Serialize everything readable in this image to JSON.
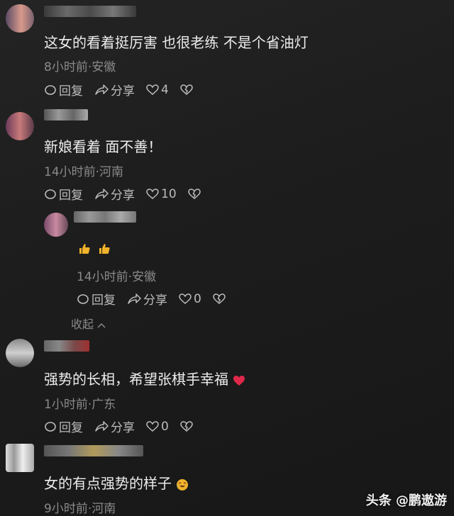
{
  "comments": [
    {
      "text": "这女的看着挺厉害 也很老练  不是个省油灯",
      "meta": "8小时前·安徽",
      "reply": "回复",
      "share": "分享",
      "likes": "4"
    },
    {
      "text": "新娘看着 面不善！",
      "meta": "14小时前·河南",
      "reply": "回复",
      "share": "分享",
      "likes": "10"
    },
    {
      "text": "",
      "meta": "14小时前·安徽",
      "reply": "回复",
      "share": "分享",
      "likes": "0"
    },
    {
      "text": "强势的长相，希望张棋手幸福",
      "meta": "1小时前·广东",
      "reply": "回复",
      "share": "分享",
      "likes": "0"
    },
    {
      "text": "女的有点强势的样子",
      "meta": "9小时前·河南",
      "reply": "",
      "share": "",
      "likes": ""
    }
  ],
  "collapse_label": "收起",
  "watermark": "头条 @鹏遨游",
  "colors": {
    "accent_heart": "#e0284a",
    "thumb": "#f2b22a"
  }
}
